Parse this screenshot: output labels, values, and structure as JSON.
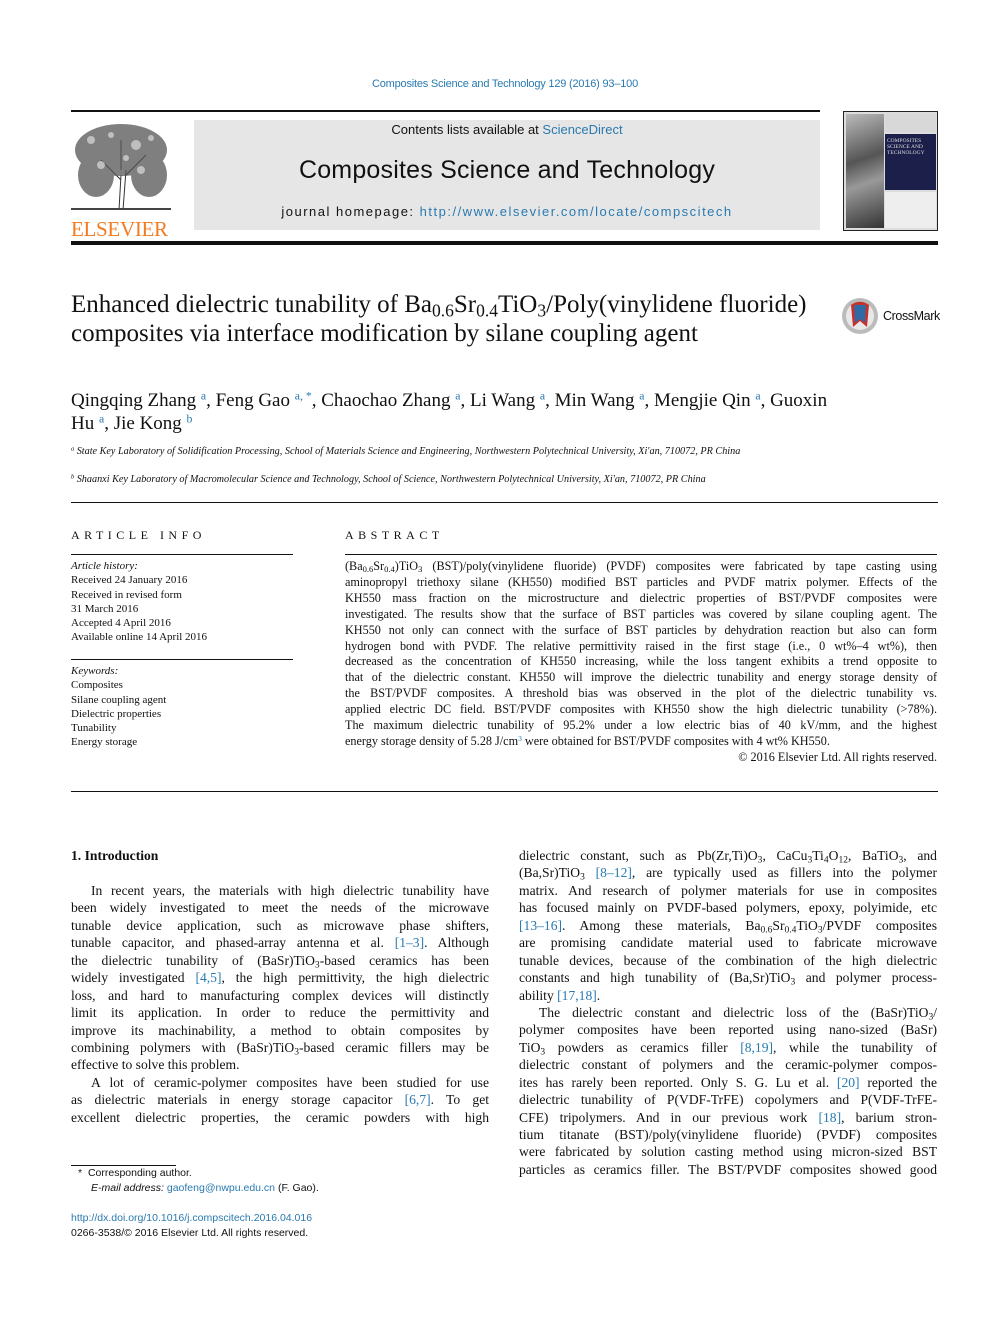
{
  "header": {
    "journal_ref": "Composites Science and Technology 129 (2016) 93–100",
    "contents_prefix": "Contents lists available at ",
    "contents_link": "ScienceDirect",
    "journal_name": "Composites Science and Technology",
    "homepage_prefix": "journal homepage: ",
    "homepage_link": "http://www.elsevier.com/locate/compscitech",
    "publisher_logo_text": "ELSEVIER",
    "cover_title": "COMPOSITES SCIENCE AND TECHNOLOGY"
  },
  "colors": {
    "link": "#2a7ab0",
    "elsevier_orange": "#f47b20",
    "header_box": "#e6e6e6",
    "cover_navy": "#1b1f4a"
  },
  "article": {
    "title": [
      "Enhanced dielectric tunability of Ba",
      {
        "sub": "0.6"
      },
      "Sr",
      {
        "sub": "0.4"
      },
      "TiO",
      {
        "sub": "3"
      },
      "/Poly(vinylidene fluoride) composites via interface modification by silane coupling agent"
    ],
    "crossmark_label": "CrossMark",
    "authors": [
      "Qingqing Zhang ",
      {
        "sup": "a"
      },
      ", Feng Gao ",
      {
        "sup": "a, *"
      },
      ", Chaochao Zhang ",
      {
        "sup": "a"
      },
      ", Li Wang ",
      {
        "sup": "a"
      },
      ", Min Wang ",
      {
        "sup": "a"
      },
      ", Mengjie Qin ",
      {
        "sup": "a"
      },
      ", Guoxin Hu ",
      {
        "sup": "a"
      },
      ", Jie Kong ",
      {
        "sup": "b"
      }
    ],
    "affiliations": [
      {
        "mark": "a",
        "text": "State Key Laboratory of Solidification Processing, School of Materials Science and Engineering, Northwestern Polytechnical University, Xi'an, 710072, PR China"
      },
      {
        "mark": "b",
        "text": "Shaanxi Key Laboratory of Macromolecular Science and Technology, School of Science, Northwestern Polytechnical University, Xi'an, 710072, PR China"
      }
    ]
  },
  "article_info": {
    "heading": "ARTICLE INFO",
    "history_label": "Article history:",
    "history": [
      "Received 24 January 2016",
      "Received in revised form",
      "31 March 2016",
      "Accepted 4 April 2016",
      "Available online 14 April 2016"
    ],
    "keywords_label": "Keywords:",
    "keywords": [
      "Composites",
      "Silane coupling agent",
      "Dielectric properties",
      "Tunability",
      "Energy storage"
    ]
  },
  "abstract": {
    "heading": "ABSTRACT",
    "lines": [
      [
        "(Ba",
        {
          "sub": "0.6"
        },
        "Sr",
        {
          "sub": "0.4"
        },
        ")TiO",
        {
          "sub": "3"
        },
        " (BST)/poly(vinylidene fluoride) (PVDF) composites were fabricated by tape casting using"
      ],
      [
        "aminopropyl triethoxy silane (KH550) modified BST particles and PVDF matrix polymer. Effects of the"
      ],
      [
        "KH550 mass fraction on the microstructure and dielectric properties of BST/PVDF composites were"
      ],
      [
        "investigated. The results show that the surface of BST particles was covered by silane coupling agent. The"
      ],
      [
        "KH550 not only can connect with the surface of BST particles by dehydration reaction but also can form"
      ],
      [
        "hydrogen bond with PVDF. The relative permittivity raised in the first stage (i.e., 0 wt%–4 wt%), then"
      ],
      [
        "decreased as the concentration of KH550 increasing, while the loss tangent exhibits a trend opposite to"
      ],
      [
        "that of the dielectric constant. KH550 will improve the dielectric tunability and energy storage density of"
      ],
      [
        "the BST/PVDF composites. A threshold bias was observed in the plot of the dielectric tunability vs."
      ],
      [
        "applied electric DC field. BST/PVDF composites with KH550 show the high dielectric tunability (>78%)."
      ],
      [
        "The maximum dielectric tunability of 95.2% under a low electric bias of 40 kV/mm, and the highest"
      ],
      [
        "energy storage density of 5.28 J/cm",
        {
          "sup": "3"
        },
        " were obtained for BST/PVDF composites with 4 wt% KH550."
      ]
    ],
    "copyright": "© 2016 Elsevier Ltd. All rights reserved."
  },
  "intro": {
    "heading": "1.  Introduction",
    "left_lines": [
      [
        "In recent years, the materials with high dielectric tunability have"
      ],
      [
        "been widely investigated to meet the needs of the microwave"
      ],
      [
        "tunable device application, such as microwave phase shifters,"
      ],
      [
        "tunable capacitor, and phased-array antenna et al. ",
        {
          "link": "[1–3]"
        },
        ". Although"
      ],
      [
        "the dielectric tunability of (BaSr)TiO",
        {
          "sub": "3"
        },
        "-based ceramics has been"
      ],
      [
        "widely investigated ",
        {
          "link": "[4,5]"
        },
        ", the high permittivity, the high dielectric"
      ],
      [
        "loss, and hard to manufacturing complex devices will distinctly"
      ],
      [
        "limit its application. In order to reduce the permittivity and"
      ],
      [
        "improve its machinability, a method to obtain composites by"
      ],
      [
        "combining polymers with (BaSr)TiO",
        {
          "sub": "3"
        },
        "-based ceramic fillers may be"
      ],
      [
        "effective to solve this problem."
      ],
      [
        "A lot of ceramic-polymer composites have been studied for use"
      ],
      [
        "as dielectric materials in energy storage capacitor ",
        {
          "link": "[6,7]"
        },
        ". To get"
      ],
      [
        "excellent dielectric properties, the ceramic powders with high"
      ]
    ],
    "right_lines": [
      [
        "dielectric constant, such as Pb(Zr,Ti)O",
        {
          "sub": "3"
        },
        ", CaCu",
        {
          "sub": "3"
        },
        "Ti",
        {
          "sub": "4"
        },
        "O",
        {
          "sub": "12"
        },
        ", BaTiO",
        {
          "sub": "3"
        },
        ", and"
      ],
      [
        "(Ba,Sr)TiO",
        {
          "sub": "3"
        },
        " ",
        {
          "link": "[8–12]"
        },
        ", are typically used as fillers into the polymer"
      ],
      [
        "matrix. And research of polymer materials for use in composites"
      ],
      [
        "has focused mainly on PVDF-based polymers, epoxy, polyimide, etc"
      ],
      [
        {
          "link": "[13–16]"
        },
        ". Among these materials, Ba",
        {
          "sub": "0.6"
        },
        "Sr",
        {
          "sub": "0.4"
        },
        "TiO",
        {
          "sub": "3"
        },
        "/PVDF composites"
      ],
      [
        "are promising candidate material used to fabricate microwave"
      ],
      [
        "tunable devices, because of the combination of the high dielectric"
      ],
      [
        "constants and high tunability of (Ba,Sr)TiO",
        {
          "sub": "3"
        },
        " and polymer process-"
      ],
      [
        "ability ",
        {
          "link": "[17,18]"
        },
        "."
      ],
      [
        "The dielectric constant and dielectric loss of the (BaSr)TiO",
        {
          "sub": "3"
        },
        "/"
      ],
      [
        "polymer composites have been reported using nano-sized (BaSr)"
      ],
      [
        "TiO",
        {
          "sub": "3"
        },
        " powders as ceramics filler ",
        {
          "link": "[8,19]"
        },
        ", while the tunability of"
      ],
      [
        "dielectric constant of polymers and the ceramic-polymer compos-"
      ],
      [
        "ites has rarely been reported. Only S. G. Lu et al. ",
        {
          "link": "[20]"
        },
        " reported the"
      ],
      [
        "dielectric tunability of P(VDF-TrFE) copolymers and P(VDF-TrFE-"
      ],
      [
        "CFE) tripolymers. And in our previous work ",
        {
          "link": "[18]"
        },
        ", barium stron-"
      ],
      [
        "tium titanate (BST)/poly(vinylidene fluoride) (PVDF) composites"
      ],
      [
        "were fabricated by solution casting method using micron-sized BST"
      ],
      [
        "particles as ceramics filler. The BST/PVDF composites showed good"
      ]
    ]
  },
  "footer": {
    "corresponding_mark": "*",
    "corresponding": "Corresponding author.",
    "email_label": "E-mail address: ",
    "email": "gaofeng@nwpu.edu.cn",
    "email_suffix": " (F. Gao).",
    "doi": "http://dx.doi.org/10.1016/j.compscitech.2016.04.016",
    "issn": "0266-3538/© 2016 Elsevier Ltd. All rights reserved."
  }
}
